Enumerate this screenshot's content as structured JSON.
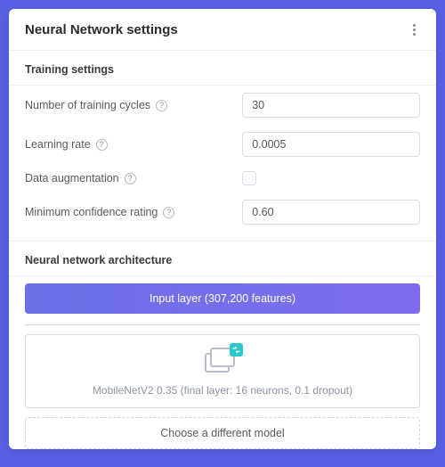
{
  "card": {
    "title": "Neural Network settings"
  },
  "training": {
    "section_title": "Training settings",
    "cycles": {
      "label": "Number of training cycles",
      "value": "30"
    },
    "lr": {
      "label": "Learning rate",
      "value": "0.0005"
    },
    "augment": {
      "label": "Data augmentation"
    },
    "confidence": {
      "label": "Minimum confidence rating",
      "value": "0.60"
    }
  },
  "arch": {
    "section_title": "Neural network architecture",
    "input_layer_label": "Input layer (307,200 features)",
    "model_label": "MobileNetV2 0.35 (final layer: 16 neurons, 0.1 dropout)",
    "choose_label": "Choose a different model"
  }
}
